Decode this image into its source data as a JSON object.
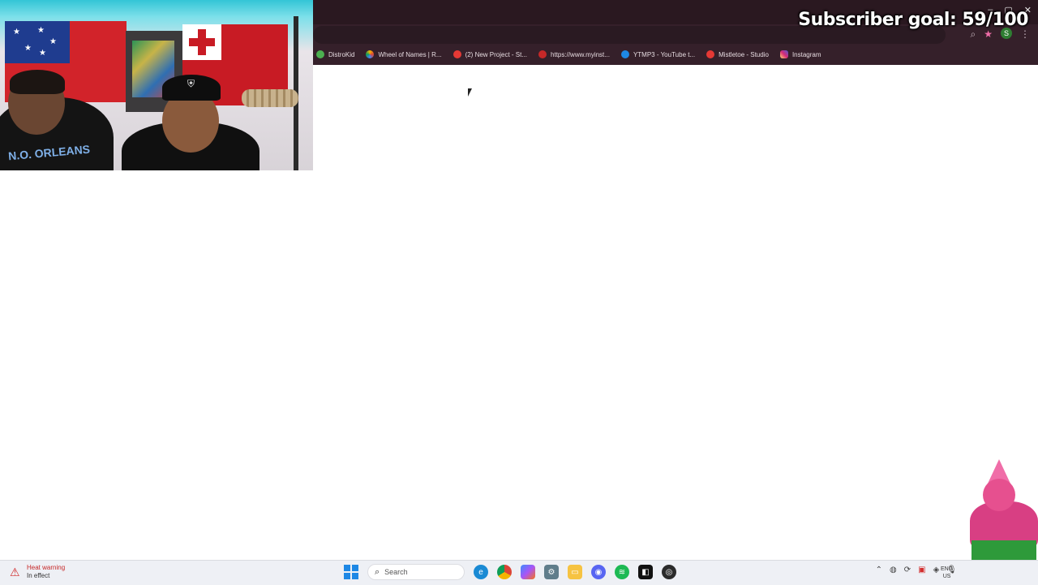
{
  "overlay": {
    "subscriber_goal": "Subscriber goal: 59/100"
  },
  "webcam": {
    "jersey_text": "N.O. ORLEANS"
  },
  "browser": {
    "bookmarks": [
      {
        "label": "DistroKid",
        "icon": "distrokid-icon",
        "color": "#4caf50"
      },
      {
        "label": "Wheel of Names | R...",
        "icon": "wheel-icon",
        "color": "#f4b400"
      },
      {
        "label": "(2) New Project - St...",
        "icon": "project-icon",
        "color": "#e53935"
      },
      {
        "label": "https://www.myinst...",
        "icon": "globe-icon",
        "color": "#c62828"
      },
      {
        "label": "YTMP3 - YouTube t...",
        "icon": "ytmp3-icon",
        "color": "#1e88e5"
      },
      {
        "label": "Mistletoe - Studio",
        "icon": "studio-icon",
        "color": "#e53935"
      },
      {
        "label": "Instagram",
        "icon": "instagram-icon",
        "color": "#d62976"
      }
    ],
    "profile_initial": "S"
  },
  "taskbar": {
    "weather_title": "Heat warning",
    "weather_subtitle": "In effect",
    "search_label": "Search",
    "apps": [
      {
        "name": "edge-icon",
        "color": "#1a8ad4"
      },
      {
        "name": "chrome-icon",
        "color": "#db4437"
      },
      {
        "name": "copilot-icon",
        "color": "#7e57c2"
      },
      {
        "name": "settings-icon",
        "color": "#607d8b"
      },
      {
        "name": "file-explorer-icon",
        "color": "#f6c342"
      },
      {
        "name": "discord-icon",
        "color": "#5865f2"
      },
      {
        "name": "spotify-icon",
        "color": "#1db954"
      },
      {
        "name": "capcut-icon",
        "color": "#111111"
      },
      {
        "name": "obs-icon",
        "color": "#2b2b2b"
      }
    ],
    "lang_line1": "ENG",
    "lang_line2": "US"
  }
}
